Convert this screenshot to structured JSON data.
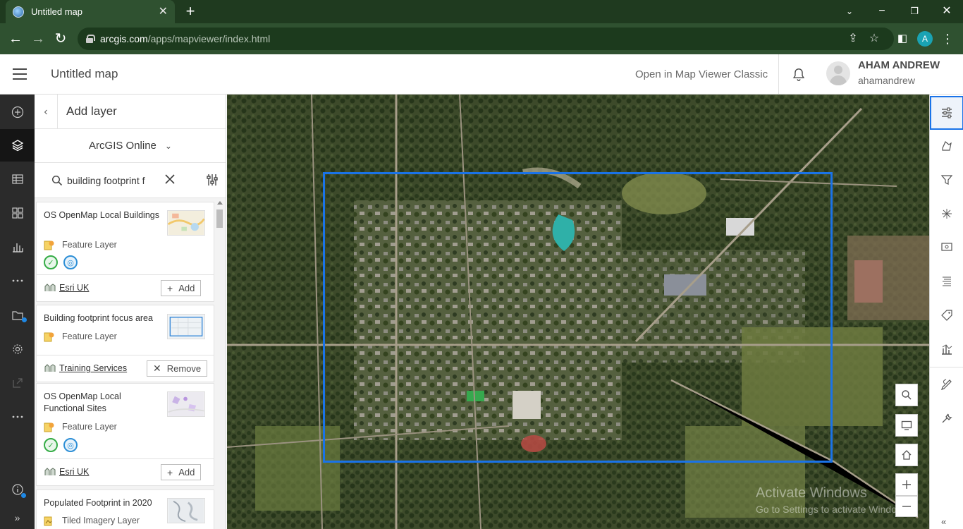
{
  "browser": {
    "tab_title": "Untitled map",
    "url_host": "arcgis.com",
    "url_path": "/apps/mapviewer/index.html",
    "profile_initial": "A"
  },
  "header": {
    "map_title": "Untitled map",
    "open_classic": "Open in Map Viewer Classic",
    "user_name": "AHAM ANDREW",
    "user_id": "ahamandrew"
  },
  "panel": {
    "title": "Add layer",
    "source": "ArcGIS Online",
    "search_value": "building footprint f",
    "results": [
      {
        "title": "OS OpenMap Local Buildings",
        "type": "Feature Layer",
        "owner": "Esri UK",
        "action": "Add",
        "badges": [
          "authoritative-icon",
          "living-atlas-icon"
        ]
      },
      {
        "title": "Building footprint focus area",
        "type": "Feature Layer",
        "owner": "Training Services",
        "action": "Remove",
        "badges": []
      },
      {
        "title": "OS OpenMap Local Functional Sites",
        "type": "Feature Layer",
        "owner": "Esri UK",
        "action": "Add",
        "badges": [
          "authoritative-icon",
          "living-atlas-icon"
        ]
      },
      {
        "title": "Populated Footprint in 2020",
        "type": "Tiled Imagery Layer",
        "owner": "",
        "action": "",
        "badges": []
      }
    ]
  },
  "map": {
    "watermark_title": "Activate Windows",
    "watermark_sub": "Go to Settings to activate Windows."
  },
  "colors": {
    "accent": "#1a73e8",
    "browser_frame": "#2f5130",
    "left_bar": "#2b2b2b"
  }
}
